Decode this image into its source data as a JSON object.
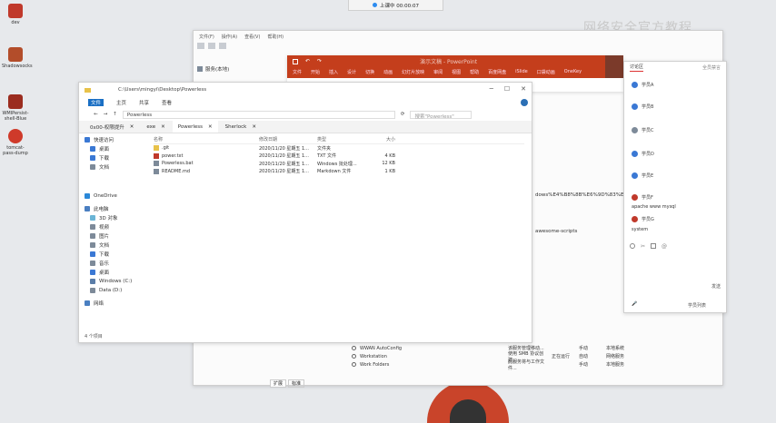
{
  "desktop": {
    "icons": [
      {
        "label": "dev",
        "color": "#c0392b"
      },
      {
        "label": "Shadowsocks",
        "color": "#b34d2a"
      },
      {
        "label": "WMIPersist-shell-Blue",
        "color": "#9b2c1f"
      },
      {
        "label": "tomcat-pass-dump",
        "color": "#cf3a2a"
      }
    ],
    "watermark": "网络安全官方教程"
  },
  "topbar": {
    "title": "上课中 00:00:07"
  },
  "mmc": {
    "menu": [
      "文件(F)",
      "操作(A)",
      "查看(V)",
      "帮助(H)"
    ],
    "sidebar_item": "服务(本地)",
    "text_line1": "dows%E4%B8%8B%E6%9D%83%E9%99%90%E6%8F%90%E5%8D%87%E7%9A%84%E5%A1",
    "text_line2": "awesome-scripts",
    "services": [
      {
        "name": "WWAN AutoConfig",
        "desc": "该服务管理移动...",
        "status": "",
        "start": "手动",
        "logon": "本地系统"
      },
      {
        "name": "Workstation",
        "desc": "使用 SMB 协议创建...",
        "status": "正在运行",
        "start": "自动",
        "logon": "网络服务"
      },
      {
        "name": "Work Folders",
        "desc": "此服务将与工作文件...",
        "status": "",
        "start": "手动",
        "logon": "本地服务"
      }
    ],
    "bottom_tabs": [
      "扩展",
      "标准"
    ]
  },
  "explorer": {
    "title": "C:\\Users\\mingyi\\Desktop\\Powerless",
    "ribbon": [
      "文件",
      "主页",
      "共享",
      "查看"
    ],
    "address": "Powerless",
    "search_placeholder": "搜索\"Powerless\"",
    "tabs": [
      "0x00-权限提升",
      "exe",
      "Powerless",
      "Sherlock"
    ],
    "nav": [
      {
        "label": "快速访问",
        "color": "#3a78d4"
      },
      {
        "label": "桌面",
        "color": "#3a78d4"
      },
      {
        "label": "下载",
        "color": "#3a78d4"
      },
      {
        "label": "文档",
        "color": "#7d8a99"
      },
      {
        "label": "OneDrive",
        "color": "#2b88d8"
      },
      {
        "label": "此电脑",
        "color": "#4a7fc1"
      },
      {
        "label": "3D 对象",
        "color": "#6bb5d6"
      },
      {
        "label": "视频",
        "color": "#7d8a99"
      },
      {
        "label": "图片",
        "color": "#7d8a99"
      },
      {
        "label": "文档",
        "color": "#7d8a99"
      },
      {
        "label": "下载",
        "color": "#3a78d4"
      },
      {
        "label": "音乐",
        "color": "#7d8a99"
      },
      {
        "label": "桌面",
        "color": "#3a78d4"
      },
      {
        "label": "Windows (C:)",
        "color": "#5a7da8"
      },
      {
        "label": "Data (D:)",
        "color": "#7d8a99"
      },
      {
        "label": "网络",
        "color": "#4a7fc1"
      }
    ],
    "columns": [
      "名称",
      "修改日期",
      "类型",
      "大小"
    ],
    "files": [
      {
        "name": ".git",
        "date": "2020/11/20 星期五 1...",
        "type": "文件夹",
        "size": "",
        "color": "#e8c24a"
      },
      {
        "name": "power.txt",
        "date": "2020/11/20 星期五 1...",
        "type": "TXT 文件",
        "size": "4 KB",
        "color": "#c0392b"
      },
      {
        "name": "Powerless.bat",
        "date": "2020/11/20 星期五 1...",
        "type": "Windows 批处理...",
        "size": "12 KB",
        "color": "#7d8a99"
      },
      {
        "name": "README.md",
        "date": "2020/11/20 星期五 1...",
        "type": "Markdown 文件",
        "size": "1 KB",
        "color": "#7d8a99"
      }
    ],
    "status": "4 个项目"
  },
  "powerpoint": {
    "title": "演示文稿 - PowerPoint",
    "tabs": [
      "文件",
      "开始",
      "插入",
      "设计",
      "切换",
      "动画",
      "幻灯片放映",
      "审阅",
      "视图",
      "帮助",
      "百度网盘",
      "iSlide",
      "口袋动画",
      "OneKey"
    ]
  },
  "chat": {
    "header": [
      "讨论区",
      "全员禁言"
    ],
    "messages": [
      {
        "user": "学员A",
        "text": "",
        "color": "#3a78d4"
      },
      {
        "user": "学员B",
        "text": "",
        "color": "#3a78d4"
      },
      {
        "user": "学员C",
        "text": "",
        "color": "#7d8a99"
      },
      {
        "user": "学员D",
        "text": "",
        "color": "#3a78d4"
      },
      {
        "user": "学员E",
        "text": "",
        "color": "#3a78d4"
      },
      {
        "user": "学员F",
        "text": "apache www mysql",
        "color": "#c0392b"
      },
      {
        "user": "学员G",
        "text": "system",
        "color": "#c0392b"
      }
    ],
    "send": "发送",
    "footer": "学员列表"
  }
}
